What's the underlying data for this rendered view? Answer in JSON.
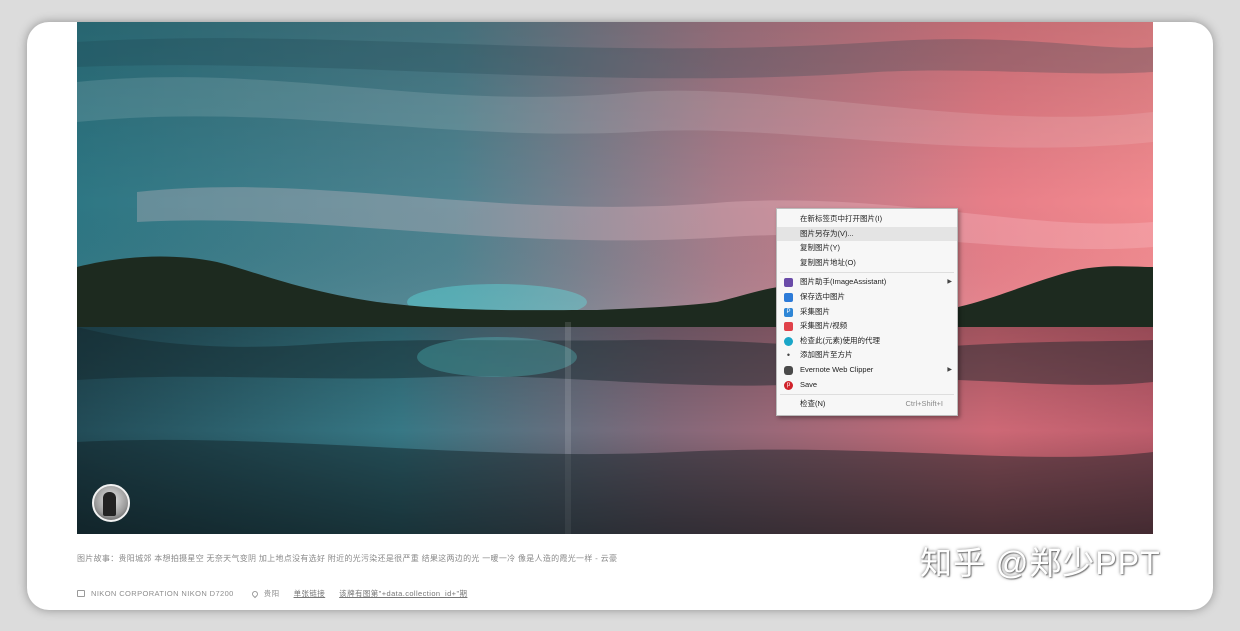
{
  "caption": "图片故事：贵阳城郊 本想拍摄星空 无奈天气变阴 加上地点没有选好 附近的光污染还是很严重 结果这两边的光 一暖一冷 像是人造的霞光一样 - 云豪",
  "meta": {
    "camera": "NIKON CORPORATION NIKON D7200",
    "location": "贵阳",
    "link1": "单张链接",
    "link2": "该牌有图第\"+data.collection_id+\"期"
  },
  "watermark": "知乎 @郑少PPT",
  "context_menu": {
    "items": [
      {
        "label": "在新标签页中打开图片(I)"
      },
      {
        "label": "图片另存为(V)..."
      },
      {
        "label": "复制图片(Y)"
      },
      {
        "label": "复制图片地址(O)"
      },
      {
        "label": "图片助手(ImageAssistant)"
      },
      {
        "label": "保存选中图片"
      },
      {
        "label": "采集图片"
      },
      {
        "label": "采集图片/视频"
      },
      {
        "label": "检查此(元素)使用的代理"
      },
      {
        "label": "添加图片至方片"
      },
      {
        "label": "Evernote Web Clipper"
      },
      {
        "label": "Save"
      },
      {
        "label": "检查(N)",
        "shortcut": "Ctrl+Shift+I"
      }
    ]
  },
  "colors": {
    "accent_sky_left": "#2f7a86",
    "accent_sky_right": "#f07a85",
    "menu_highlight": "#e4e4e4"
  }
}
